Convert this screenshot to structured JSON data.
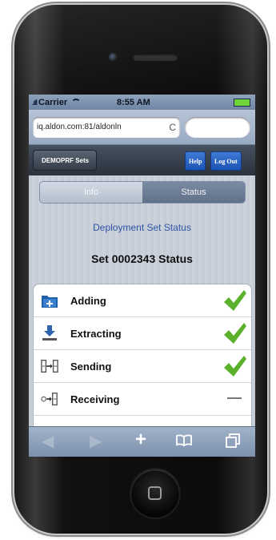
{
  "status_bar": {
    "signal": ".ıll",
    "carrier": "Carrier",
    "time": "8:55 AM"
  },
  "browser": {
    "url": "iq.aldon.com:81/aldonln",
    "reload": "C"
  },
  "nav": {
    "back_label": "DEMOPRF Sets",
    "help_label": "Help",
    "logout_label": "Log Out"
  },
  "segments": {
    "info": "Info",
    "status": "Status",
    "selected": "Status"
  },
  "main": {
    "heading": "Deployment Set Status",
    "set_title": "Set 0002343 Status",
    "steps": [
      {
        "label": "Adding",
        "state": "done",
        "icon": "add-folder-icon"
      },
      {
        "label": "Extracting",
        "state": "done",
        "icon": "extract-icon"
      },
      {
        "label": "Sending",
        "state": "done",
        "icon": "send-icon"
      },
      {
        "label": "Receiving",
        "state": "pending",
        "icon": "receive-icon",
        "status_text": "—"
      }
    ]
  },
  "toolbar": {
    "add": "+"
  },
  "colors": {
    "check": "#5bb02c",
    "link_blue": "#2f54a6",
    "nav_button": "#2a64c8"
  }
}
